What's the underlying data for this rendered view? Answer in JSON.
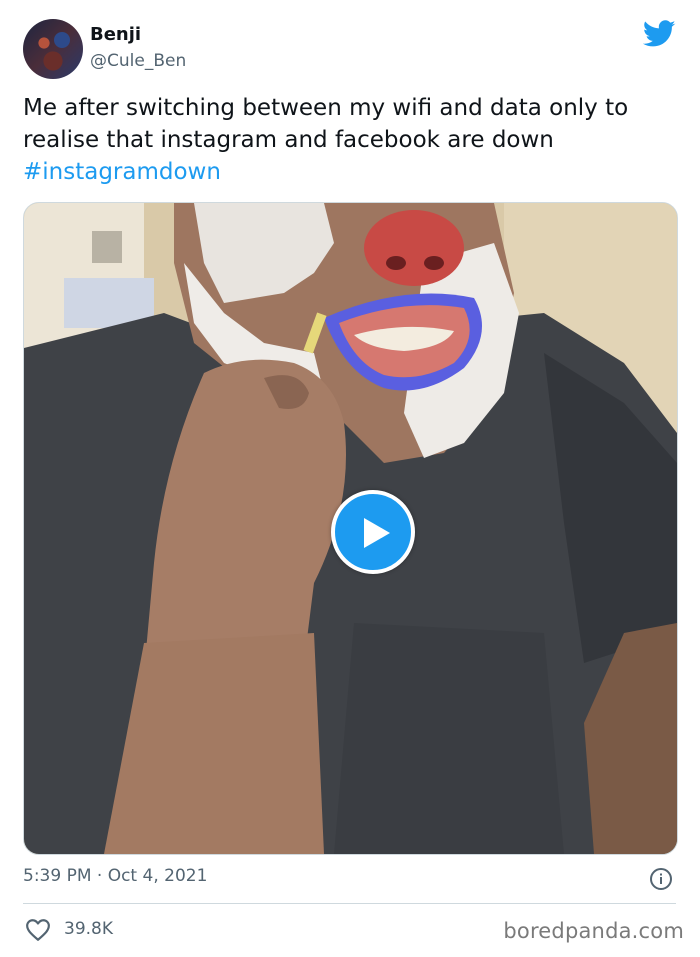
{
  "author": {
    "name": "Benji",
    "handle": "@Cule_Ben"
  },
  "tweet": {
    "text": "Me after switching between my wifi and data only to realise that instagram and facebook are down",
    "hashtag": "#instagramdown"
  },
  "meta": {
    "timestamp": "5:39 PM · Oct 4, 2021",
    "likes": "39.8K"
  },
  "watermark": "boredpanda.com",
  "icons": {
    "brand": "twitter-icon",
    "info": "info-icon",
    "like": "heart-icon",
    "play": "play-icon"
  },
  "colors": {
    "accent": "#1d9bf0",
    "secondary_text": "#536471",
    "primary_text": "#0f1419"
  }
}
